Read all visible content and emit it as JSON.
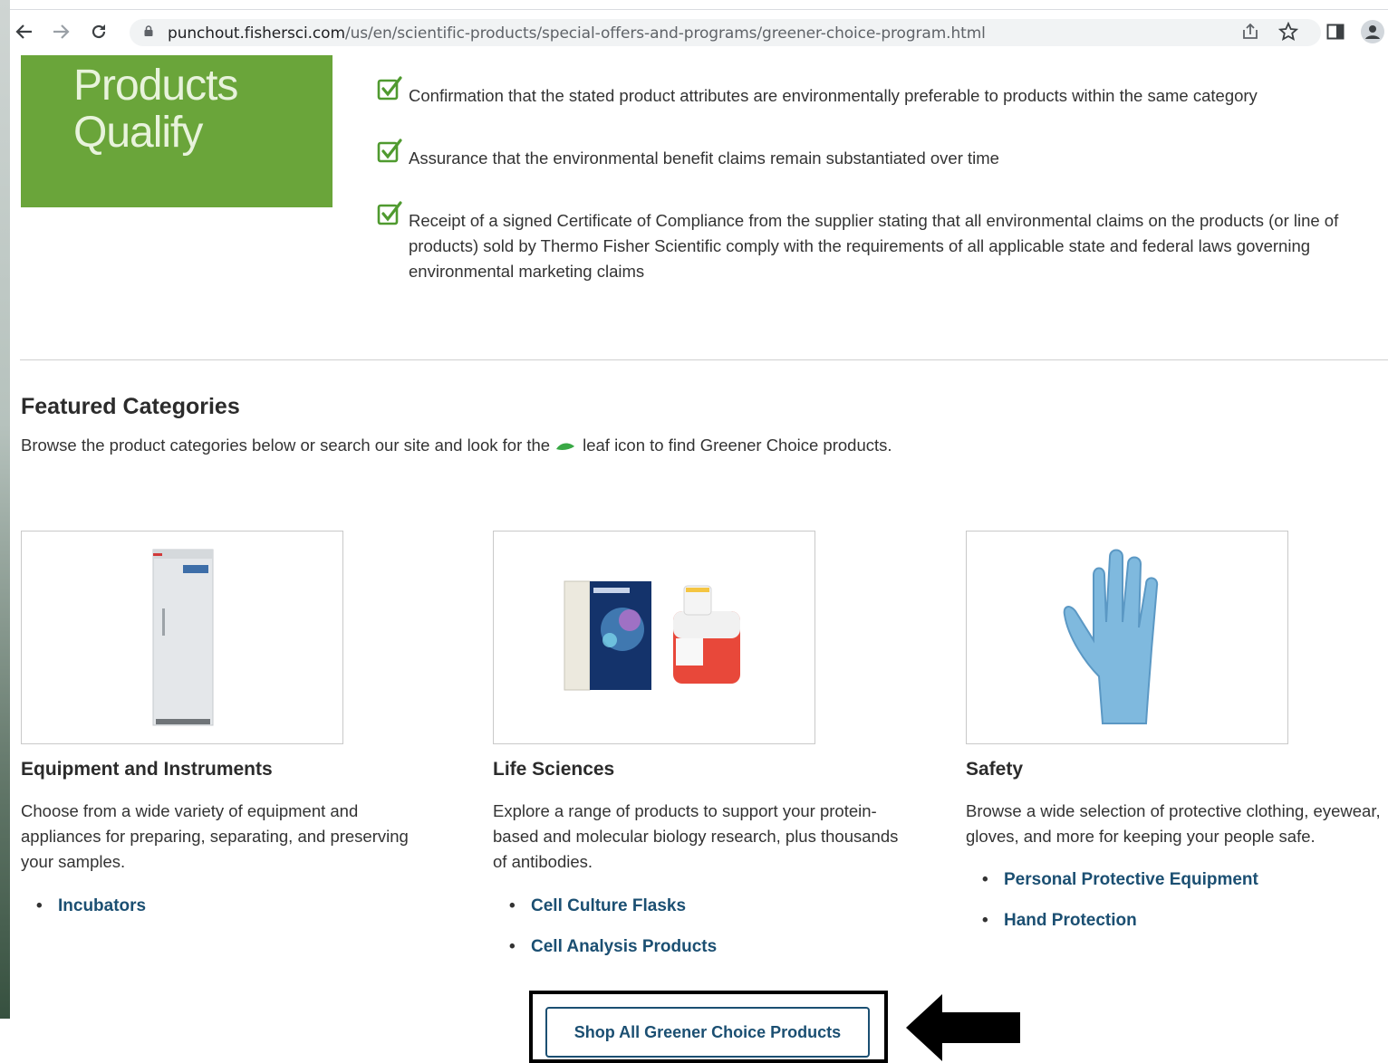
{
  "browser": {
    "url_host": "punchout.fishersci.com",
    "url_path": "/us/en/scientific-products/special-offers-and-programs/greener-choice-program.html",
    "icons": [
      "back-icon",
      "forward-icon",
      "reload-icon",
      "lock-icon",
      "share-icon",
      "star-icon",
      "side-panel-icon",
      "profile-icon"
    ]
  },
  "hero": {
    "title_line1": "Products",
    "title_line2": "Qualify",
    "color": "#6aa53a"
  },
  "checklist": [
    {
      "text": "Confirmation that the stated product attributes are environmentally preferable to products within the same category"
    },
    {
      "text": "Assurance that the environmental benefit claims remain substantiated over time"
    },
    {
      "text": "Receipt of a signed Certificate of Compliance from the supplier stating that all environmental claims on the products (or line of products) sold by Thermo Fisher Scientific comply with the requirements of all applicable state and federal laws governing environmental marketing claims"
    }
  ],
  "featured": {
    "title": "Featured Categories",
    "desc_before": "Browse the product categories below or search our site and look for the",
    "desc_after": "leaf icon to find Greener Choice products."
  },
  "categories": [
    {
      "title": "Equipment and Instruments",
      "desc": "Choose from a wide variety of equipment and appliances for preparing, separating, and preserving your samples.",
      "image": "freezer-image",
      "links": [
        "Incubators"
      ]
    },
    {
      "title": "Life Sciences",
      "desc": "Explore a range of products to support your protein-based and molecular biology research, plus thousands of antibodies.",
      "image": "cell-culture-image",
      "links": [
        "Cell Culture Flasks",
        "Cell Analysis Products"
      ]
    },
    {
      "title": "Safety",
      "desc": "Browse a wide selection of protective clothing, eyewear, gloves, and more for keeping your people safe.",
      "image": "glove-image",
      "links": [
        "Personal Protective Equipment",
        "Hand Protection"
      ]
    }
  ],
  "cta": {
    "label": "Shop All Greener Choice Products",
    "color": "#1b4f72"
  },
  "colors": {
    "link": "#1b4f72",
    "check": "#4f9a2f"
  }
}
